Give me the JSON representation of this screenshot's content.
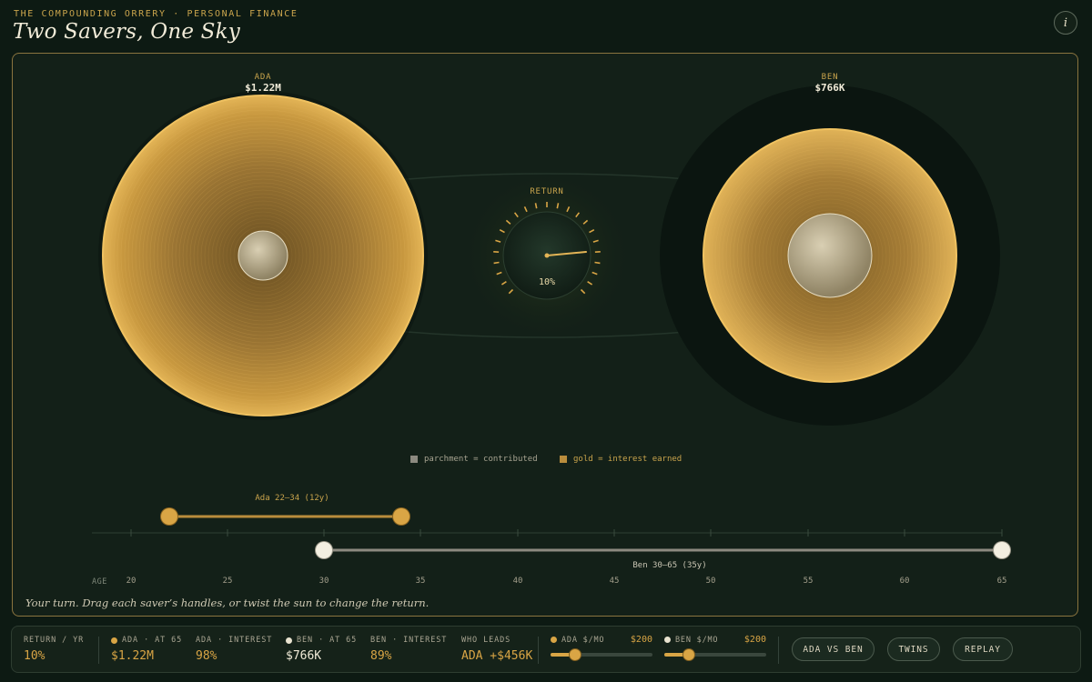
{
  "header": {
    "eyebrow": "THE COMPOUNDING ORRERY · PERSONAL FINANCE",
    "title": "Two Savers, One Sky",
    "info_icon": "i"
  },
  "savers": {
    "ada": {
      "name": "ADA",
      "total": "$1.22M"
    },
    "ben": {
      "name": "BEN",
      "total": "$766K"
    }
  },
  "sun": {
    "label": "RETURN",
    "value": "10%",
    "return_rate": 0.1
  },
  "legend": {
    "contributed": "parchment = contributed",
    "interest": "gold = interest earned"
  },
  "timeline": {
    "age_label": "AGE",
    "ticks": [
      "20",
      "25",
      "30",
      "35",
      "40",
      "45",
      "50",
      "55",
      "60",
      "65"
    ],
    "ada_range": "Ada 22–34  (12y)",
    "ben_range": "Ben 30–65  (35y)",
    "ada_start_age": 22,
    "ada_end_age": 34,
    "ben_start_age": 30,
    "ben_end_age": 65
  },
  "footnote": "Your turn. Drag each saver’s handles, or twist the sun to change the return.",
  "stats": {
    "return_label": "RETURN / YR",
    "return_value": "10%",
    "ada_at65_label": "ADA · AT 65",
    "ada_at65_value": "$1.22M",
    "ada_interest_label": "ADA · INTEREST",
    "ada_interest_value": "98%",
    "ben_at65_label": "BEN · AT 65",
    "ben_at65_value": "$766K",
    "ben_interest_label": "BEN · INTEREST",
    "ben_interest_value": "89%",
    "leader_label": "WHO LEADS",
    "leader_value": "ADA +$456K"
  },
  "controls": {
    "ada_monthly_label": "ADA $/MO",
    "ada_monthly_value": "$200",
    "ada_slider_fraction": 0.24,
    "ben_monthly_label": "BEN $/MO",
    "ben_monthly_value": "$200",
    "ben_slider_fraction": 0.24,
    "compare_button": "ADA VS BEN",
    "twins_button": "TWINS",
    "replay_button": "REPLAY"
  },
  "colors": {
    "background": "#0d1a13",
    "gold": "#d9a545",
    "parchment": "#f1ebd8"
  }
}
